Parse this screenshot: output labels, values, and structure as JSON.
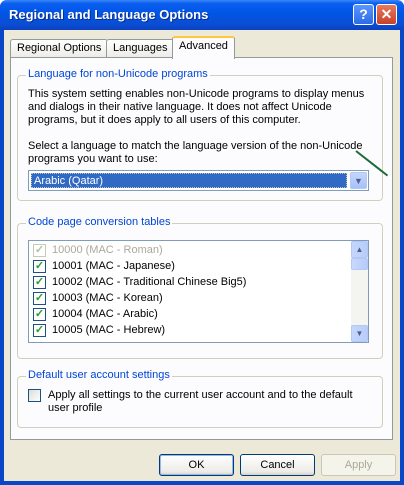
{
  "window": {
    "title": "Regional and Language Options",
    "help_glyph": "?",
    "close_glyph": "✕"
  },
  "tabs": [
    {
      "label": "Regional Options"
    },
    {
      "label": "Languages"
    },
    {
      "label": "Advanced"
    }
  ],
  "non_unicode": {
    "legend": "Language for non-Unicode programs",
    "description": "This system setting enables non-Unicode programs to display menus and dialogs in their native language. It does not affect Unicode programs, but it does apply to all users of this computer.",
    "select_prompt": "Select a language to match the language version of the non-Unicode programs you want to use:",
    "selected_language": "Arabic (Qatar)"
  },
  "code_pages": {
    "legend": "Code page conversion tables",
    "items": [
      {
        "label": "10000 (MAC - Roman)",
        "checked": true,
        "disabled": true
      },
      {
        "label": "10001 (MAC - Japanese)",
        "checked": true,
        "disabled": false
      },
      {
        "label": "10002 (MAC - Traditional Chinese Big5)",
        "checked": true,
        "disabled": false
      },
      {
        "label": "10003 (MAC - Korean)",
        "checked": true,
        "disabled": false
      },
      {
        "label": "10004 (MAC - Arabic)",
        "checked": true,
        "disabled": false
      },
      {
        "label": "10005 (MAC - Hebrew)",
        "checked": true,
        "disabled": false
      }
    ]
  },
  "default_user": {
    "legend": "Default user account settings",
    "checkbox_label": "Apply all settings to the current user account and to the default user profile",
    "checked": false
  },
  "buttons": {
    "ok": "OK",
    "cancel": "Cancel",
    "apply": "Apply"
  },
  "colors": {
    "titlebar": "#0055e5",
    "accent_legend": "#0046d5",
    "selection": "#316ac5"
  }
}
